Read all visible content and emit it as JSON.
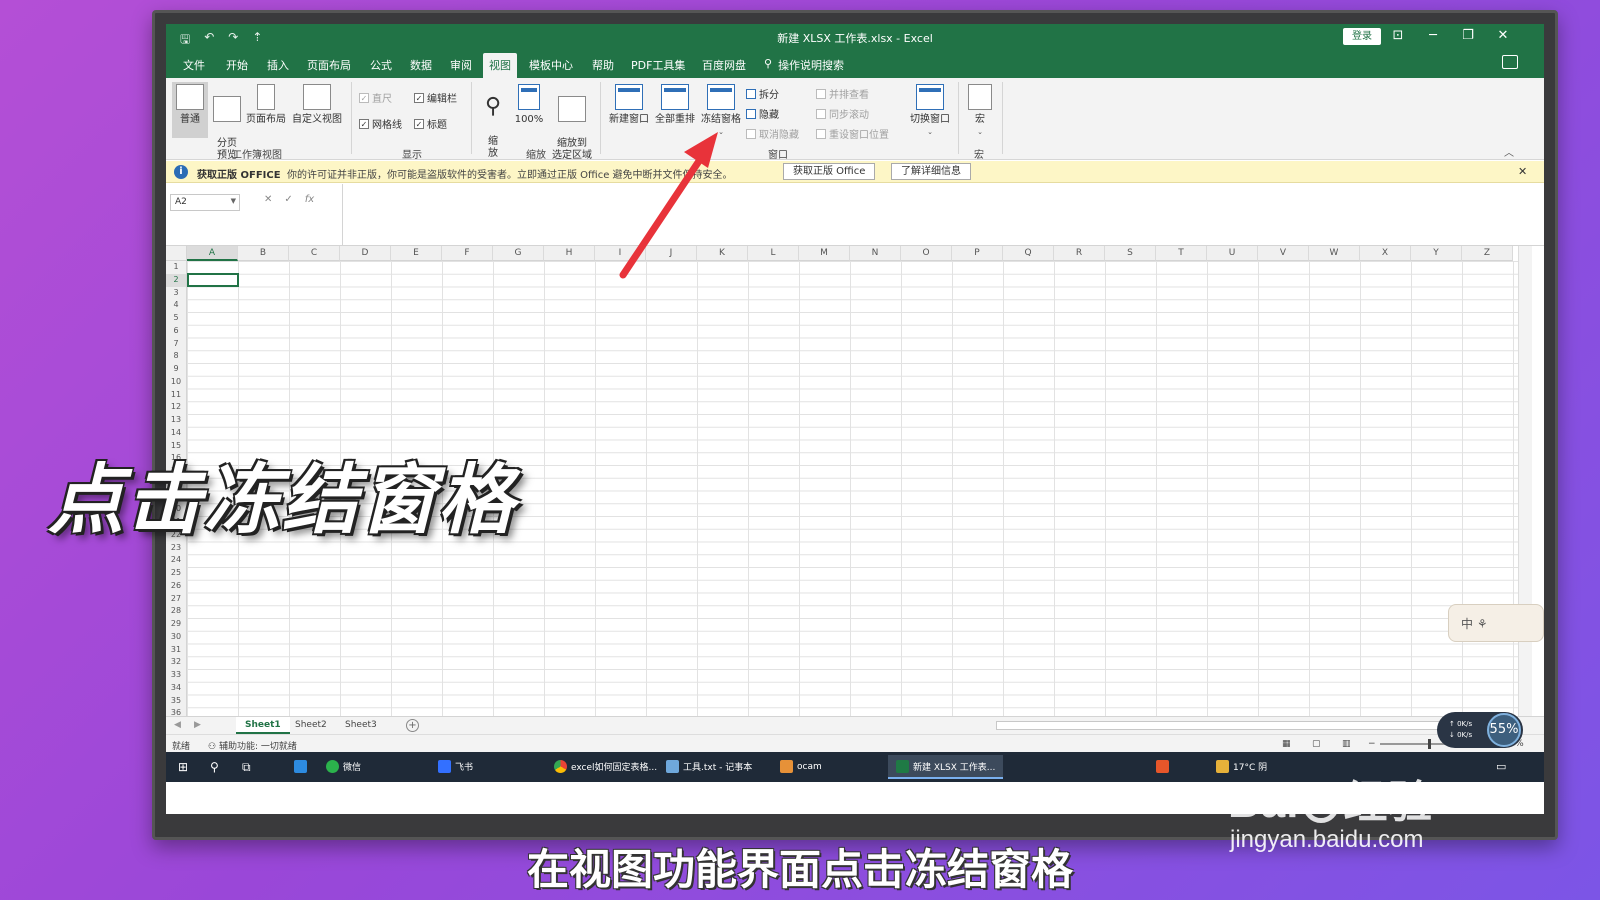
{
  "titlebar": {
    "qat": [
      "🖫",
      "↶",
      "↷",
      "⇡"
    ],
    "title": "新建 XLSX 工作表.xlsx  -  Excel",
    "login": "登录",
    "controls": [
      "⊡",
      "─",
      "❐",
      "✕"
    ]
  },
  "menu": {
    "tabs": [
      "文件",
      "开始",
      "插入",
      "页面布局",
      "公式",
      "数据",
      "审阅",
      "视图",
      "模板中心",
      "帮助",
      "PDF工具集",
      "百度网盘"
    ],
    "active_tab": "视图",
    "search": "操作说明搜索"
  },
  "ribbon": {
    "workbook_views": {
      "label": "工作簿视图",
      "items": [
        "普通",
        "分页\n预览",
        "页面布局",
        "自定义视图"
      ]
    },
    "show": {
      "label": "显示",
      "ruler": "直尺",
      "formula_bar": "编辑栏",
      "gridlines": "网格线",
      "headings": "标题"
    },
    "zoom": {
      "label": "缩放",
      "zoom": "缩\n放",
      "hundred": "100%",
      "zoom_selection": "缩放到\n选定区域"
    },
    "window": {
      "label": "窗口",
      "new_window": "新建窗口",
      "arrange_all": "全部重排",
      "freeze_panes": "冻结窗格",
      "split": "拆分",
      "hide": "隐藏",
      "unhide": "取消隐藏",
      "view_side_by_side": "并排查看",
      "sync_scroll": "同步滚动",
      "reset_position": "重设窗口位置",
      "switch_windows": "切换窗口"
    },
    "macros": {
      "label": "宏",
      "macro": "宏"
    }
  },
  "notice": {
    "title": "获取正版 OFFICE",
    "message": "你的许可证并非正版，你可能是盗版软件的受害者。立即通过正版 Office 避免中断并",
    "message_tail": "文件保持安全。",
    "btn_get": "获取正版 Office",
    "btn_learn": "了解详细信息"
  },
  "formula": {
    "name_box": "A2",
    "cancel": "✕",
    "enter": "✓",
    "fx": "fx"
  },
  "grid": {
    "columns": [
      "A",
      "B",
      "C",
      "D",
      "E",
      "F",
      "G",
      "H",
      "I",
      "J",
      "K",
      "L",
      "M",
      "N",
      "O",
      "P",
      "Q",
      "R",
      "S",
      "T",
      "U",
      "V",
      "W",
      "X",
      "Y",
      "Z"
    ],
    "selected_column": "A",
    "rows": [
      "1",
      "2",
      "3",
      "4",
      "5",
      "6",
      "7",
      "8",
      "9",
      "10",
      "11",
      "12",
      "13",
      "14",
      "15",
      "16",
      "17",
      "18",
      "19",
      "20",
      "21",
      "22",
      "23",
      "24",
      "25",
      "26",
      "27",
      "28",
      "29",
      "30",
      "31",
      "32",
      "33",
      "34",
      "35",
      "36"
    ],
    "selected_row": "2"
  },
  "sheets": {
    "tabs": [
      "Sheet1",
      "Sheet2",
      "Sheet3"
    ],
    "active": "Sheet1",
    "add": "+"
  },
  "status": {
    "ready": "就绪",
    "accessibility": "辅助功能: 一切就绪",
    "zoom": "100%"
  },
  "taskbar": {
    "items": [
      "微信",
      "飞书",
      "excel如何固定表格...",
      "工具.txt - 记事本",
      "ocam",
      "新建 XLSX 工作表..."
    ],
    "weather": "17°C 阴"
  },
  "widgets": {
    "ime": "中",
    "speed_up": "0K/s",
    "speed_down": "0K/s",
    "cpu": "55%"
  },
  "overlay": {
    "caption": "点击冻结窗格",
    "subtitle": "在视图功能界面点击冻结窗格",
    "watermark": "Baidu 经验",
    "watermark_url": "jingyan.baidu.com",
    "arrow_color": "#e8333a"
  }
}
